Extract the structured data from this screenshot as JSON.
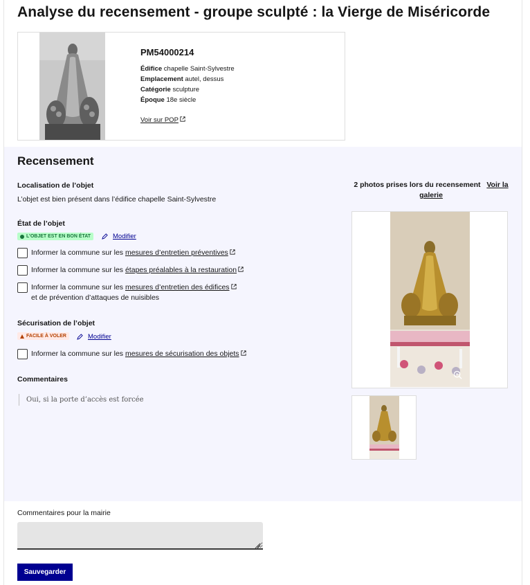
{
  "page_title": "Analyse du recensement - groupe sculpté : la Vierge de Miséricorde",
  "object": {
    "code": "PM54000214",
    "edifice_label": "Édifice",
    "edifice_value": "chapelle Saint-Sylvestre",
    "emplacement_label": "Emplacement",
    "emplacement_value": "autel, dessus",
    "categorie_label": "Catégorie",
    "categorie_value": "sculpture",
    "epoque_label": "Époque",
    "epoque_value": "18e siècle",
    "pop_link": "Voir sur POP"
  },
  "recensement": {
    "title": "Recensement",
    "localisation_label": "Localisation de l’objet",
    "localisation_text": "L’objet est bien présent dans l’édifice chapelle Saint-Sylvestre",
    "etat_label": "État de l’objet",
    "etat_badge": "L’OBJET EST EN BON ÉTAT",
    "modify_label": "Modifier",
    "checks_etat": [
      {
        "prefix": "Informer la commune sur les ",
        "link": "mesures d’entretien préventives",
        "suffix": ""
      },
      {
        "prefix": "Informer la commune sur les ",
        "link": "étapes préalables à la restauration",
        "suffix": ""
      },
      {
        "prefix": "Informer la commune sur les ",
        "link": "mesures d’entretien des édifices",
        "suffix": "et de prévention d’attaques de nuisibles"
      }
    ],
    "securisation_label": "Sécurisation de l’objet",
    "securisation_badge": "FACILE À VOLER",
    "check_securisation": {
      "prefix": "Informer la commune sur les ",
      "link": "mesures de sécurisation des objets"
    },
    "commentaires_label": "Commentaires",
    "commentaire_text": "Oui, si la porte d’accès est forcée",
    "photos_title": "2 photos prises lors du recensement",
    "photos_link": "Voir la galerie"
  },
  "mairie": {
    "label": "Commentaires pour la mairie",
    "value": "",
    "save_label": "Sauvegarder"
  },
  "colors": {
    "primary": "#000091",
    "success_bg": "#b8fec9",
    "success_text": "#18753c",
    "warning_bg": "#ffe9e6",
    "warning_text": "#b34000",
    "section_bg": "#f5f5fe"
  },
  "icons": [
    "external-link-icon",
    "pencil-icon",
    "check-circle-icon",
    "warning-icon",
    "zoom-icon",
    "resize-handle-icon"
  ]
}
